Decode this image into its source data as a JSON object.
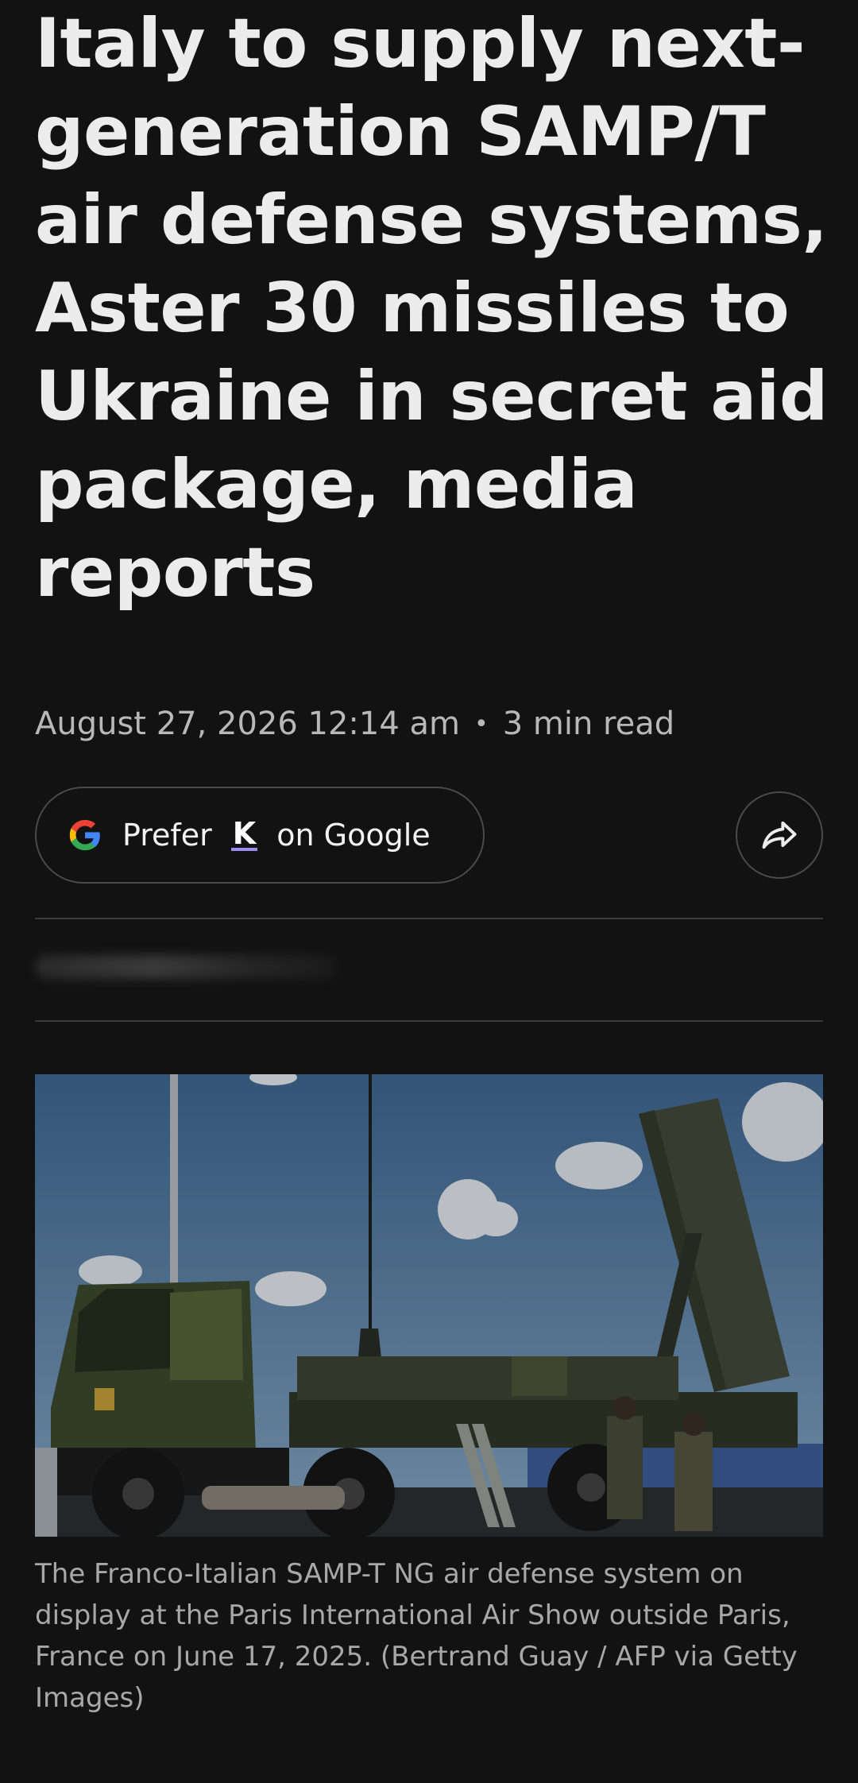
{
  "article": {
    "headline": "Italy to supply next-generation SAMP/T air defense systems, Aster 30 missiles to Ukraine in secret aid package, media reports",
    "date": "August 27, 2026 12:14 am",
    "separator": "•",
    "read_time": "3 min read"
  },
  "actions": {
    "prefer_label_before": "Prefer",
    "prefer_brand": "K",
    "prefer_label_after": "on Google",
    "google_icon": "google-g-icon",
    "share_icon": "share-arrow-icon"
  },
  "image": {
    "caption": "The Franco-Italian SAMP-T NG air defense system on display at the Paris International Air Show outside Paris, France on June 17, 2025. (Bertrand Guay / AFP via Getty Images)"
  },
  "colors": {
    "background": "#121212",
    "text": "#ececec",
    "muted": "#b8b8b8",
    "border": "#4a4a4a",
    "brand_underline": "#9c8cf2"
  }
}
